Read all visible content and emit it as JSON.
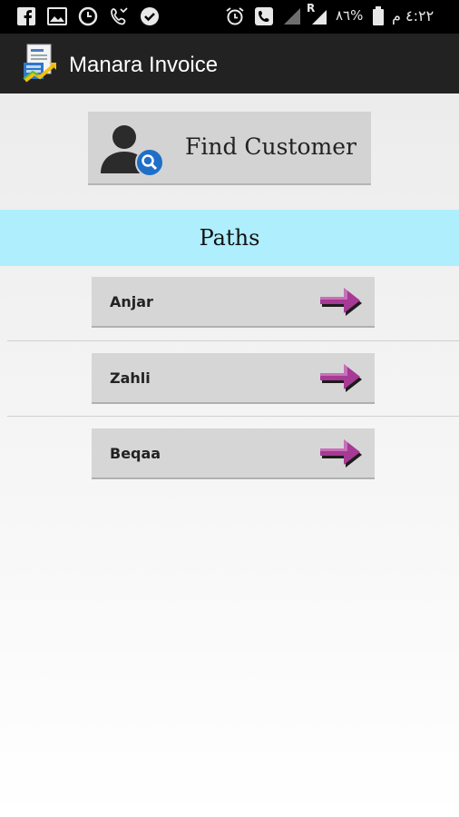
{
  "status_bar": {
    "icons": [
      "facebook-icon",
      "image-icon",
      "clock-icon",
      "phone-missed-icon",
      "check-icon",
      "alarm-icon",
      "phone-icon",
      "signal-icon",
      "roaming-signal-icon",
      "battery-icon"
    ],
    "roaming_label": "R",
    "battery_percent": "٨٦%",
    "time": "٤:٢٢ م"
  },
  "app_bar": {
    "title": "Manara Invoice",
    "logo_icon": "invoice-chart-icon"
  },
  "find_customer": {
    "label": "Find Customer",
    "icon": "person-search-icon"
  },
  "paths_section": {
    "title": "Paths",
    "items": [
      {
        "label": "Anjar",
        "icon": "arrow-right-icon"
      },
      {
        "label": "Zahli",
        "icon": "arrow-right-icon"
      },
      {
        "label": "Beqaa",
        "icon": "arrow-right-icon"
      }
    ]
  },
  "colors": {
    "status_bar_bg": "#000000",
    "app_bar_bg": "#222222",
    "paths_banner_bg": "#aeeefd",
    "button_bg": "#d6d6d6",
    "arrow_color": "#9b2f8a"
  }
}
